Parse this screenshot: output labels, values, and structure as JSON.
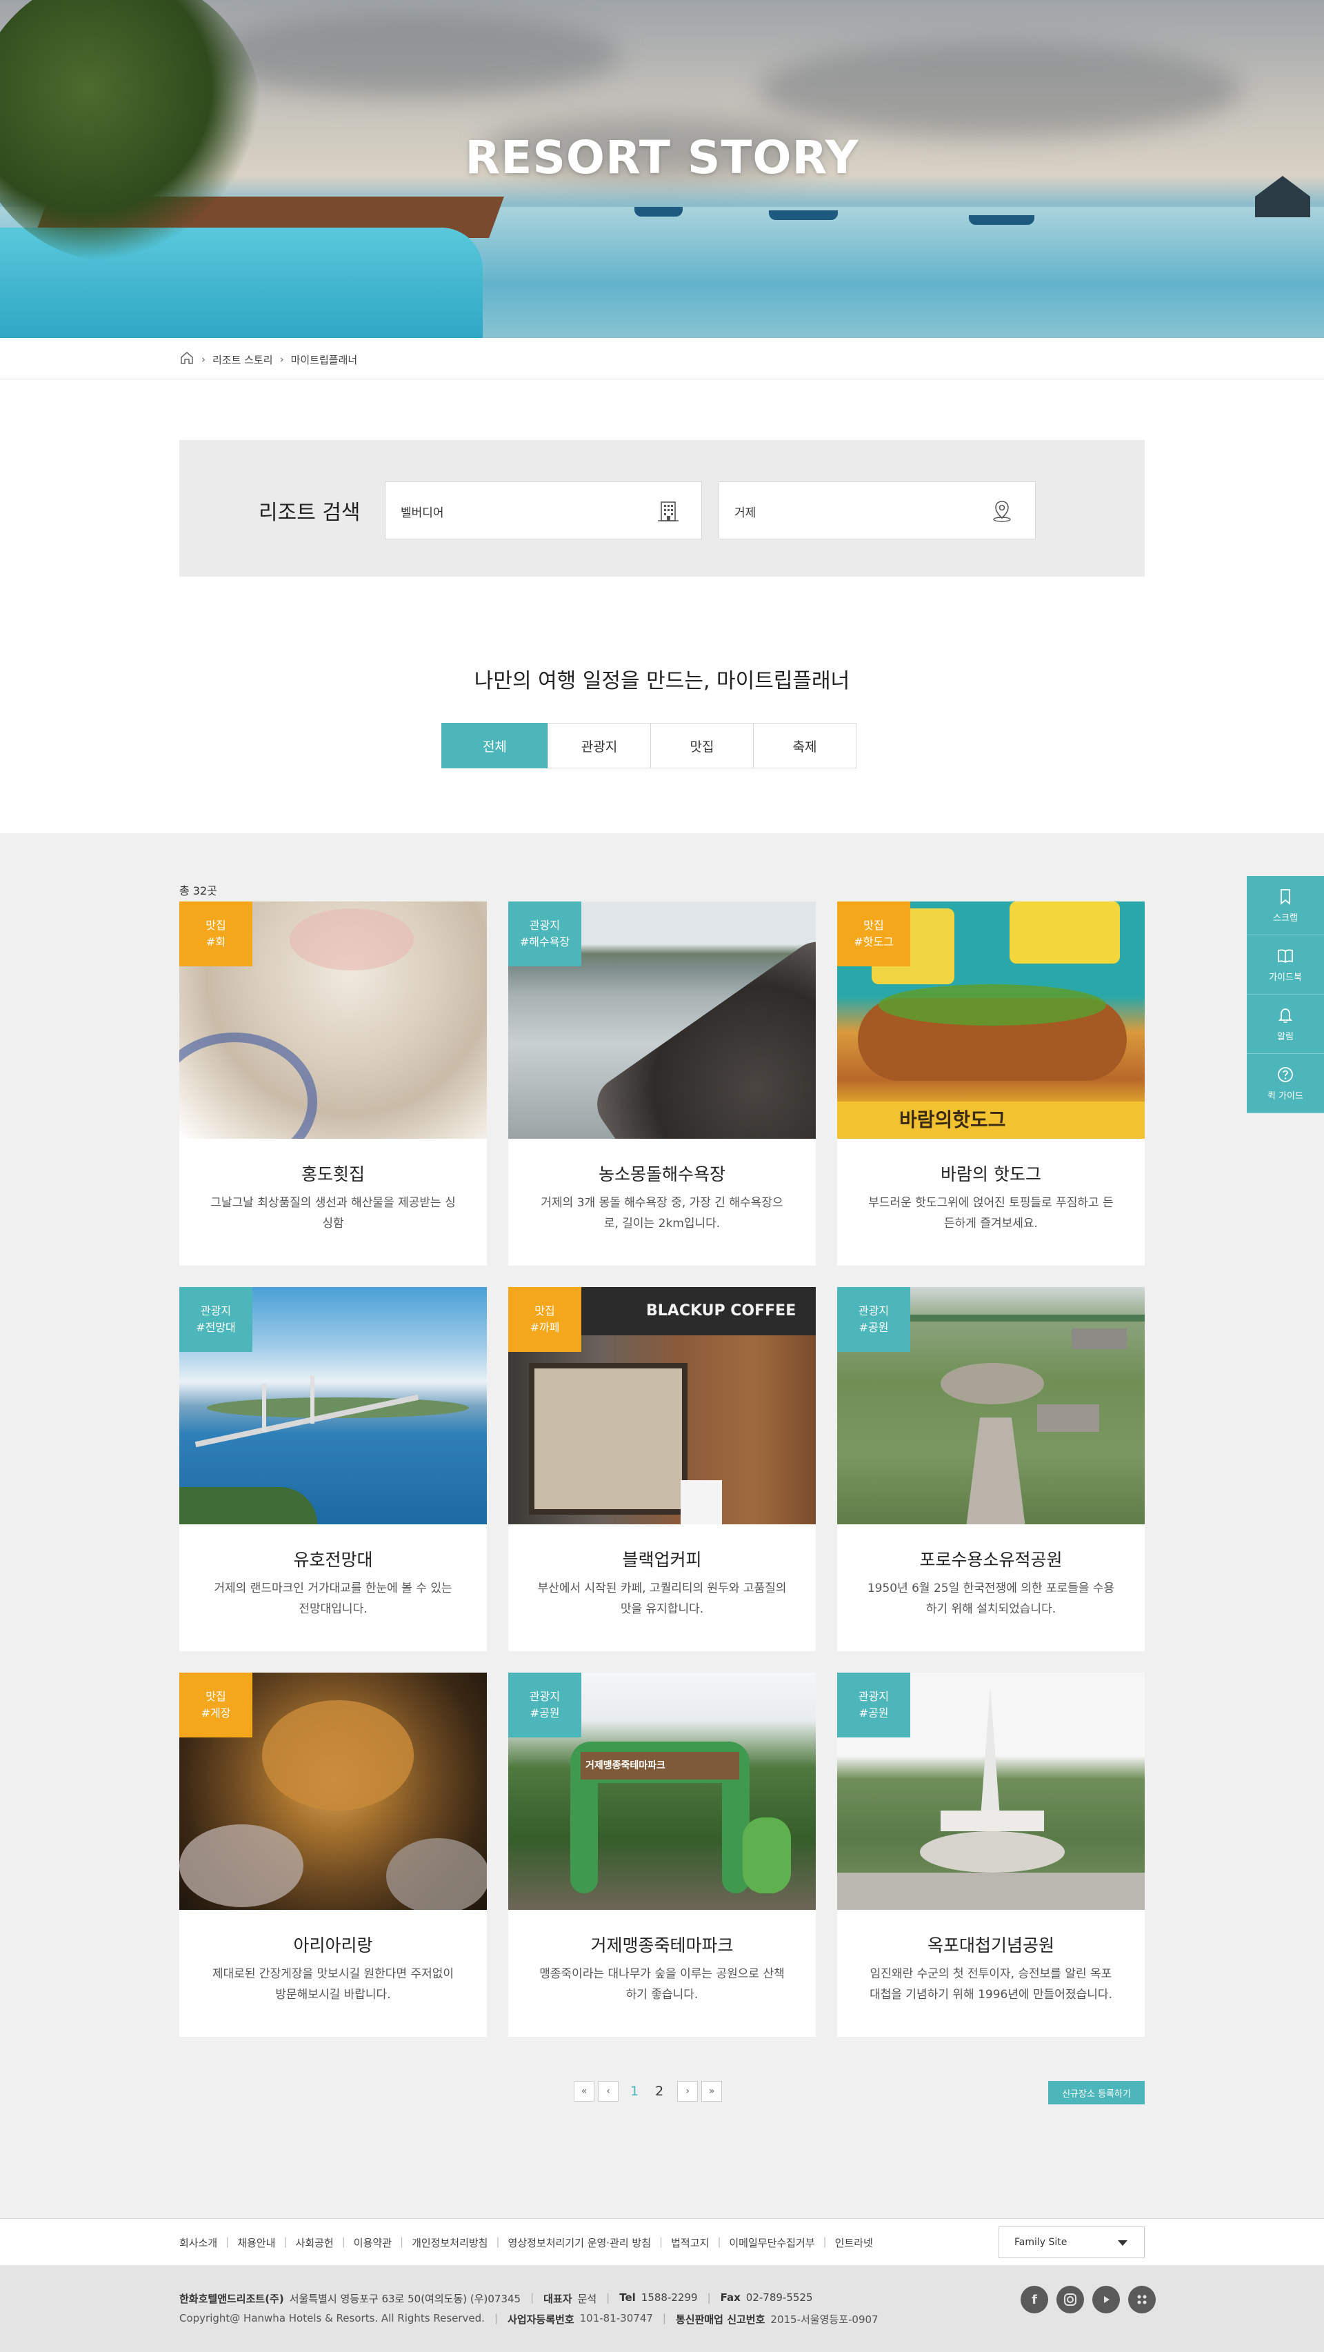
{
  "hero": {
    "title": "RESORT STORY"
  },
  "breadcrumb": {
    "items": [
      "리조트 스토리",
      "마이트립플래너"
    ]
  },
  "search": {
    "label": "리조트 검색",
    "resort_value": "벨버디어",
    "location_value": "거제"
  },
  "planner": {
    "title": "나만의 여행 일정을 만드는, 마이트립플래너",
    "tabs": [
      "전체",
      "관광지",
      "맛집",
      "축제"
    ]
  },
  "list": {
    "count": "총 32곳",
    "cards": [
      {
        "cat": "맛집",
        "tag": "#회",
        "name": "홍도횟집",
        "desc": "그날그날 최상품질의 생선과 해산물을 제공받는 싱싱함"
      },
      {
        "cat": "관광지",
        "tag": "#해수욕장",
        "name": "농소몽돌해수욕장",
        "desc": "거제의 3개 몽돌 해수욕장 중, 가장 긴 해수욕장으로, 길이는 2km입니다."
      },
      {
        "cat": "맛집",
        "tag": "#핫도그",
        "name": "바람의 핫도그",
        "desc": "부드러운 핫도그위에 얹어진 토핑들로 푸짐하고 든든하게 즐겨보세요."
      },
      {
        "cat": "관광지",
        "tag": "#전망대",
        "name": "유호전망대",
        "desc": "거제의 랜드마크인 거가대교를 한눈에 볼 수 있는 전망대입니다."
      },
      {
        "cat": "맛집",
        "tag": "#까페",
        "name": "블랙업커피",
        "desc": "부산에서 시작된 카페, 고퀄리티의 원두와 고품질의 맛을 유지합니다."
      },
      {
        "cat": "관광지",
        "tag": "#공원",
        "name": "포로수용소유적공원",
        "desc": "1950년 6월 25일 한국전쟁에 의한 포로들을 수용하기 위해 설치되었습니다."
      },
      {
        "cat": "맛집",
        "tag": "#게장",
        "name": "아리아리랑",
        "desc": "제대로된 간장게장을 맛보시길 원한다면 주저없이 방문해보시길 바랍니다."
      },
      {
        "cat": "관광지",
        "tag": "#공원",
        "name": "거제맹종죽테마파크",
        "desc": "맹종죽이라는 대나무가 숲을 이루는 공원으로 산책하기 좋습니다."
      },
      {
        "cat": "관광지",
        "tag": "#공원",
        "name": "옥포대첩기념공원",
        "desc": "임진왜란 수군의 첫 전투이자, 승전보를 알린 옥포대첩을 기념하기 위해 1996년에 만들어졌습니다."
      }
    ],
    "image_texts": {
      "hotdog": "바람의핫도그",
      "coffee": "BLACKUP COFFEE",
      "park": "거제맹종죽테마파크"
    }
  },
  "pager": {
    "first": "«",
    "prev": "‹",
    "pages": [
      "1",
      "2"
    ],
    "next": "›",
    "last": "»"
  },
  "register_button": "신규장소 등록하기",
  "side": [
    "스크랩",
    "가이드북",
    "알림",
    "퀵 가이드"
  ],
  "footer": {
    "links": [
      "회사소개",
      "채용안내",
      "사회공헌",
      "이용약관",
      "개인정보처리방침",
      "영상정보처리기기 운영·관리 방침",
      "법적고지",
      "이메일무단수집거부",
      "인트라넷"
    ],
    "family_site": "Family Site",
    "company": "한화호텔앤드리조트(주)",
    "address": "서울특별시 영등포구 63로 50(여의도동) (우)07345",
    "ceo_label": "대표자",
    "ceo": "문석",
    "tel_label": "Tel",
    "tel": "1588-2299",
    "fax_label": "Fax",
    "fax": "02-789-5525",
    "copyright": "Copyright@ Hanwha Hotels & Resorts. All Rights Reserved.",
    "biz_label": "사업자등록번호",
    "biz": "101-81-30747",
    "mail_label": "통신판매업 신고번호",
    "mail": "2015-서울영등포-0907"
  },
  "colors": {
    "accent": "#4cb6ba",
    "food": "#f5a71c"
  }
}
